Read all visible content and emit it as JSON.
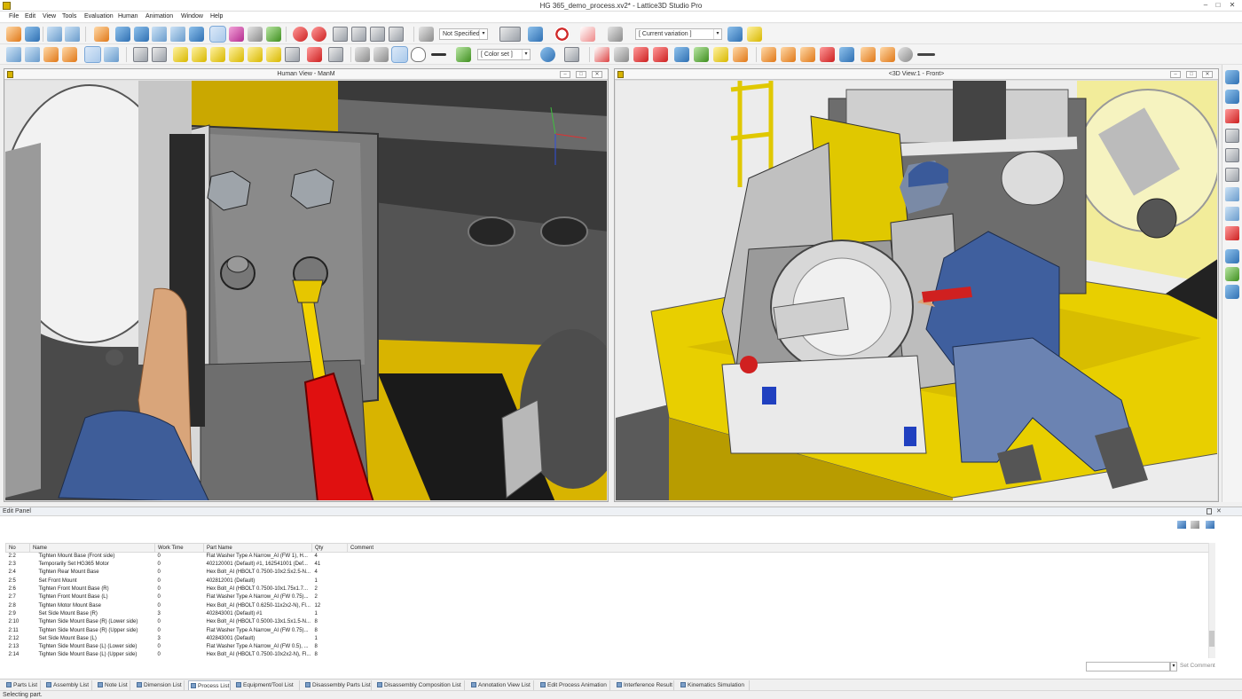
{
  "window": {
    "title": "HG 365_demo_process.xv2* - Lattice3D Studio Pro"
  },
  "menu": [
    "File",
    "Edit",
    "View",
    "Tools",
    "Evaluation",
    "Human",
    "Animation",
    "Window",
    "Help"
  ],
  "toolbar": {
    "not_specified": "Not Specified",
    "current_variation": "[ Current variation ]",
    "color_set": "[ Color set ]"
  },
  "left_view": {
    "title": "Human View - ManM"
  },
  "right_view": {
    "title": "<3D View:1 - Front>"
  },
  "edit_panel": {
    "title": "Edit Panel",
    "columns": [
      "No",
      "Name",
      "Work Time",
      "Part Name",
      "Qty",
      "Comment"
    ],
    "rows": [
      [
        "2:2",
        "Tighten Mount Base (Front side)",
        "0",
        "Flat Washer Type A Narrow_AI (FW 1), H...",
        "4",
        ""
      ],
      [
        "2:3",
        "Temporarily Set HG365 Motor",
        "0",
        "402120001 (Default) #1, 162541001 (Def...",
        "41",
        ""
      ],
      [
        "2:4",
        "Tighten Rear Mount Base",
        "0",
        "Hex Bolt_AI (HBOLT 0.7500-10x2.5x2.5-N...",
        "4",
        ""
      ],
      [
        "2:5",
        "Set Front Mount",
        "0",
        "402812001 (Default)",
        "1",
        ""
      ],
      [
        "2:6",
        "Tighten Front Mount Base (R)",
        "0",
        "Hex Bolt_AI (HBOLT 0.7500-10x1.75x1.7...",
        "2",
        ""
      ],
      [
        "2:7",
        "Tighten Front Mount Base (L)",
        "0",
        "Flat Washer Type A Narrow_AI (FW 0.75)...",
        "2",
        ""
      ],
      [
        "2:8",
        "Tighten Motor Mount Base",
        "0",
        "Hex Bolt_AI (HBOLT 0.6250-11x2x2-N), Fl...",
        "12",
        ""
      ],
      [
        "2:9",
        "Set Side Mount Base (R)",
        "3",
        "402843001 (Default) #1",
        "1",
        ""
      ],
      [
        "2:10",
        "Tighten Side Mount Base (R) (Lower side)",
        "0",
        "Hex Bolt_AI (HBOLT 0.5000-13x1.5x1.5-N...",
        "8",
        ""
      ],
      [
        "2:11",
        "Tighten Side Mount Base (R) (Upper side)",
        "0",
        "Flat Washer Type A Narrow_AI (FW 0.75)...",
        "8",
        ""
      ],
      [
        "2:12",
        "Set Side Mount Base (L)",
        "3",
        "402843001 (Default)",
        "1",
        ""
      ],
      [
        "2:13",
        "Tighten Side Mount Base (L) (Lower side)",
        "0",
        "Flat Washer Type A Narrow_AI (FW 0.5), ...",
        "8",
        ""
      ],
      [
        "2:14",
        "Tighten Side Mount Base (L) (Upper side)",
        "0",
        "Hex Bolt_AI (HBOLT 0.7500-10x2x2-N), Fl...",
        "8",
        ""
      ]
    ],
    "set_comment": "Set Comment"
  },
  "tabs": [
    "Parts List",
    "Assembly List",
    "Note List",
    "Dimension List",
    "Process List",
    "Equipment/Tool List",
    "Disassembly Parts List",
    "Disassembly Composition List",
    "Annotation View List",
    "Edit Process Animation",
    "Interference Result",
    "Kinematics Simulation"
  ],
  "active_tab": "Process List",
  "status": "Selecting part."
}
